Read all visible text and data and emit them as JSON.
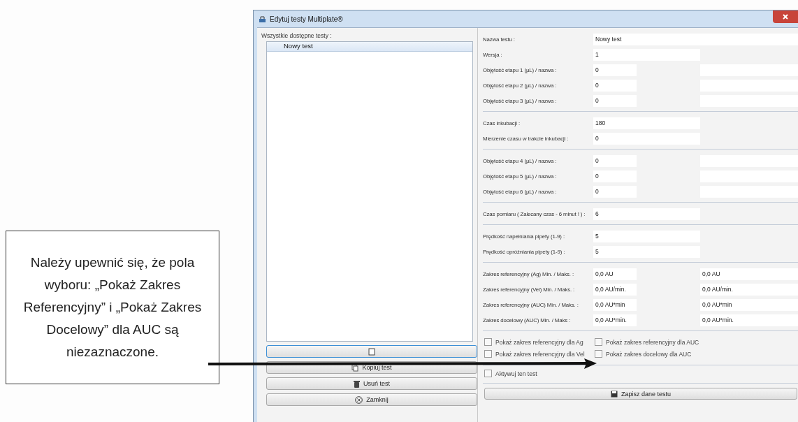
{
  "callout": {
    "text": "Należy upewnić się, że pola wyboru: „Pokaż Zakres Referencyjny” i „Pokaż Zakres Docelowy” dla AUC są niezaznaczone."
  },
  "window": {
    "title": "Edytuj testy Multiplate®"
  },
  "tests_panel": {
    "label": "Wszystkie dostępne testy :",
    "items": [
      {
        "label": "Nowy test",
        "selected": true
      }
    ],
    "buttons": [
      {
        "kind": "covered",
        "focused": true
      },
      {
        "kind": "copy",
        "label": "Kopiuj test",
        "focused": false
      },
      {
        "kind": "delete",
        "label": "Usuń test",
        "focused": false
      },
      {
        "kind": "close",
        "label": "Zamknij",
        "focused": false
      }
    ]
  },
  "form": {
    "groups": [
      {
        "rows": [
          {
            "kind": "full",
            "label": "Nazwa testu :",
            "value": "Nowy test"
          },
          {
            "kind": "medium",
            "label": "Wersja :",
            "value": "1"
          },
          {
            "kind": "pair",
            "label": "Objętość etapu 1 (µL) / nazwa :",
            "value": "0"
          },
          {
            "kind": "pair",
            "label": "Objętość etapu 2 (µL) / nazwa :",
            "value": "0"
          },
          {
            "kind": "pair",
            "label": "Objętość etapu 3 (µL) / nazwa :",
            "value": "0"
          }
        ]
      },
      {
        "rows": [
          {
            "kind": "medium",
            "label": "Czas inkubacji :",
            "value": "180"
          },
          {
            "kind": "medium",
            "label": "Mierzenie czasu w trakcie inkubacji :",
            "value": "0"
          }
        ]
      },
      {
        "rows": [
          {
            "kind": "pair",
            "label": "Objętość etapu 4 (µL) / nazwa :",
            "value": "0"
          },
          {
            "kind": "pair",
            "label": "Objętość etapu 5 (µL) / nazwa :",
            "value": "0"
          },
          {
            "kind": "pair",
            "label": "Objętość etapu 6 (µL) / nazwa :",
            "value": "0"
          }
        ]
      },
      {
        "rows": [
          {
            "kind": "medium",
            "label": "Czas pomiaru ( Zalecany czas - 6 minut ! ) :",
            "value": "6"
          }
        ]
      },
      {
        "rows": [
          {
            "kind": "medium",
            "label": "Prędkość napełniania pipety (1-9) :",
            "value": "5"
          },
          {
            "kind": "medium",
            "label": "Prędkość opróżniania pipety (1-9) :",
            "value": "5"
          }
        ]
      },
      {
        "rows": [
          {
            "kind": "pair",
            "label": "Zakres referencyjny (Ag) Min. / Maks. :",
            "value": "0,0 AU",
            "value_2": "0,0 AU"
          },
          {
            "kind": "pair",
            "label": "Zakres referencyjny (Vel) Min. / Maks. :",
            "value": "0,0 AU/min.",
            "value_2": "0,0 AU/min."
          },
          {
            "kind": "pair",
            "label": "Zakres referencyjny (AUC) Min. / Maks. :",
            "value": "0,0 AU*min",
            "value_2": "0,0 AU*min"
          },
          {
            "kind": "pair",
            "label": "Zakres docelowy (AUC) Min. / Maks :",
            "value": "0,0 AU*min.",
            "value_2": "0,0 AU*min."
          }
        ]
      }
    ],
    "checkboxes": [
      {
        "label": "Pokaż zakres referencyjny dla Ag",
        "checked": false
      },
      {
        "label": "Pokaż zakres referencyjny dla AUC",
        "checked": false
      },
      {
        "label": "Pokaż zakres referencyjny dla Vel",
        "checked": false
      },
      {
        "label": "Pokaż zakres docelowy dla AUC",
        "checked": false
      }
    ],
    "activate": {
      "label": "Aktywuj ten test",
      "checked": false
    },
    "save_button": {
      "label": "Zapisz dane testu"
    }
  }
}
